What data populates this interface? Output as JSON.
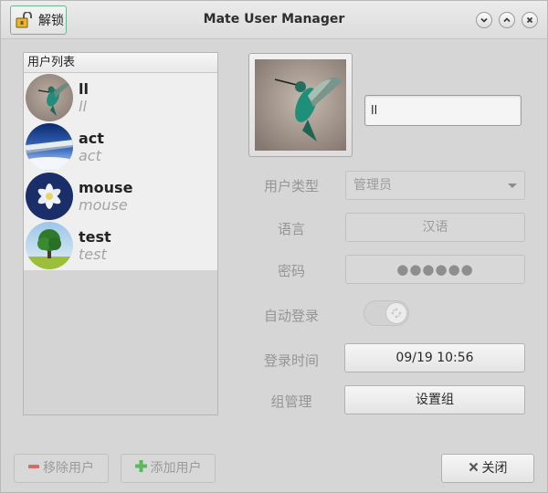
{
  "window": {
    "title": "Mate User Manager",
    "unlock_label": "解锁"
  },
  "user_list": {
    "header": "用户列表",
    "users": [
      {
        "name": "ll",
        "realname": "ll",
        "avatar": "hummingbird"
      },
      {
        "name": "act",
        "realname": "act",
        "avatar": "airplane-wing"
      },
      {
        "name": "mouse",
        "realname": "mouse",
        "avatar": "white-flower"
      },
      {
        "name": "test",
        "realname": "test",
        "avatar": "tree"
      }
    ]
  },
  "details": {
    "username_value": "ll",
    "account_type_label": "用户类型",
    "account_type_value": "管理员",
    "language_label": "语言",
    "language_value": "汉语",
    "password_label": "密码",
    "password_value": "●●●●●●",
    "autologin_label": "自动登录",
    "autologin_enabled": false,
    "last_login_label": "登录时间",
    "last_login_value": "09/19 10:56",
    "group_label": "组管理",
    "group_button": "设置组"
  },
  "footer": {
    "remove_user": "移除用户",
    "add_user": "添加用户",
    "close": "关闭"
  },
  "colors": {
    "focus_border": "#6fb58f",
    "remove_icon": "#d9534f",
    "add_icon": "#4caf50"
  }
}
